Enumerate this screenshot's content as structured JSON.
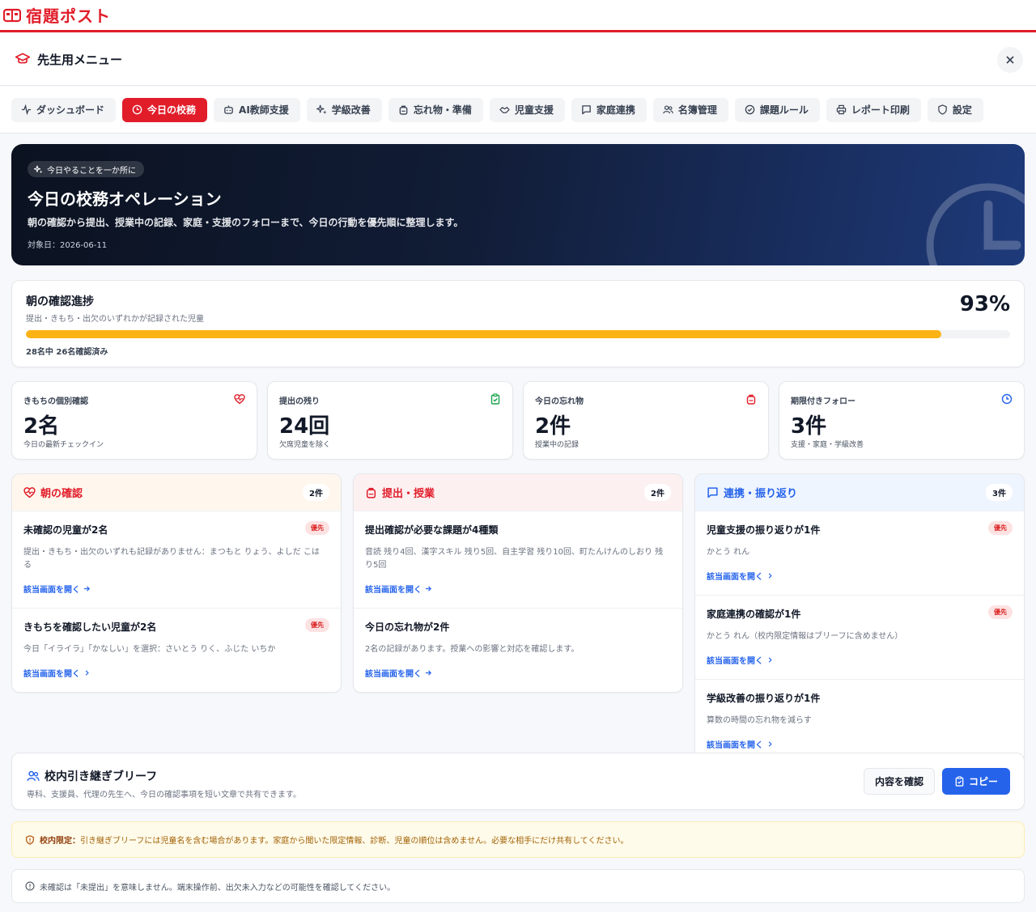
{
  "brand": {
    "title": "宿題ポスト",
    "color": "#e11d2a"
  },
  "menu": {
    "title": "先生用メニュー",
    "close_icon": "close-icon"
  },
  "tabs": [
    {
      "label": "ダッシュボード",
      "icon": "pulse-icon"
    },
    {
      "label": "今日の校務",
      "icon": "clock-icon",
      "active": true
    },
    {
      "label": "AI教師支援",
      "icon": "robot-icon"
    },
    {
      "label": "学級改善",
      "icon": "sparkle-icon"
    },
    {
      "label": "忘れ物・準備",
      "icon": "backpack-icon"
    },
    {
      "label": "児童支援",
      "icon": "handshake-icon"
    },
    {
      "label": "家庭連携",
      "icon": "message-icon"
    },
    {
      "label": "名簿管理",
      "icon": "users-icon"
    },
    {
      "label": "課題ルール",
      "icon": "check-circle-icon"
    },
    {
      "label": "レポート印刷",
      "icon": "printer-icon"
    },
    {
      "label": "設定",
      "icon": "shield-icon"
    }
  ],
  "hero": {
    "chip": "今日やることを一か所に",
    "title": "今日の校務オペレーション",
    "description": "朝の確認から提出、授業中の記録、家庭・支援のフォローまで、今日の行動を優先順に整理します。",
    "date": "対象日：2026-06-11"
  },
  "progress": {
    "title": "朝の確認進捗",
    "subtitle": "提出・きもち・出欠のいずれかが記録された児童",
    "percent_label": "93%",
    "fraction": 0.93,
    "count_text": "28名中 26名確認済み",
    "bar_color": "#fbb314"
  },
  "stats": [
    {
      "label": "きもちの個別確認",
      "value": "2名",
      "note": "今日の最新チェックイン",
      "icon": "heart-pulse-icon",
      "color": "#e11d2a"
    },
    {
      "label": "提出の残り",
      "value": "24回",
      "note": "欠席児童を除く",
      "icon": "clipboard-check-icon",
      "color": "#16a34a"
    },
    {
      "label": "今日の忘れ物",
      "value": "2件",
      "note": "授業中の記録",
      "icon": "backpack-icon",
      "color": "#e11d2a"
    },
    {
      "label": "期限付きフォロー",
      "value": "3件",
      "note": "支援・家庭・学級改善",
      "icon": "clock-icon",
      "color": "#2563eb"
    }
  ],
  "columns": [
    {
      "title": "朝の確認",
      "count": "2件",
      "icon": "heart-pulse-icon",
      "color": "#e11d2a",
      "head_bg": "#fff7ed",
      "items": [
        {
          "title": "未確認の児童が2名",
          "badge": "優先",
          "desc": "提出・きもち・出欠のいずれも記録がありません：まつもと りょう、よしだ こはる",
          "link": "該当画面を開く"
        },
        {
          "title": "きもちを確認したい児童が2名",
          "badge": "優先",
          "desc": "今日「イライラ」「かなしい」を選択：さいとう りく、ふじた いちか",
          "link": "該当画面を開く"
        }
      ]
    },
    {
      "title": "提出・授業",
      "count": "2件",
      "icon": "backpack-icon",
      "color": "#e11d2a",
      "head_bg": "#fdf0f1",
      "items": [
        {
          "title": "提出確認が必要な課題が4種類",
          "badge": "",
          "desc": "音読 残り4回、漢字スキル 残り5回、自主学習 残り10回、町たんけんのしおり 残り5回",
          "link": "該当画面を開く"
        },
        {
          "title": "今日の忘れ物が2件",
          "badge": "",
          "desc": "2名の記録があります。授業への影響と対応を確認します。",
          "link": "該当画面を開く"
        }
      ]
    },
    {
      "title": "連携・振り返り",
      "count": "3件",
      "icon": "message-icon",
      "color": "#2563eb",
      "head_bg": "#eff5ff",
      "items": [
        {
          "title": "児童支援の振り返りが1件",
          "badge": "優先",
          "desc": "かとう れん",
          "link": "該当画面を開く"
        },
        {
          "title": "家庭連携の確認が1件",
          "badge": "優先",
          "desc": "かとう れん（校内限定情報はブリーフに含めません）",
          "link": "該当画面を開く"
        },
        {
          "title": "学級改善の振り返りが1件",
          "badge": "",
          "desc": "算数の時間の忘れ物を減らす",
          "link": "該当画面を開く"
        }
      ]
    }
  ],
  "brief": {
    "title": "校内引き継ぎブリーフ",
    "description": "専科、支援員、代理の先生へ、今日の確認事項を短い文章で共有できます。",
    "check_label": "内容を確認",
    "copy_label": "コピー"
  },
  "warning": {
    "label": "校内限定：",
    "text": "引き継ぎブリーフには児童名を含む場合があります。家庭から聞いた限定情報、診断、児童の順位は含めません。必要な相手にだけ共有してください。"
  },
  "note": {
    "text": "未確認は「未提出」を意味しません。端末操作前、出欠未入力などの可能性を確認してください。"
  }
}
